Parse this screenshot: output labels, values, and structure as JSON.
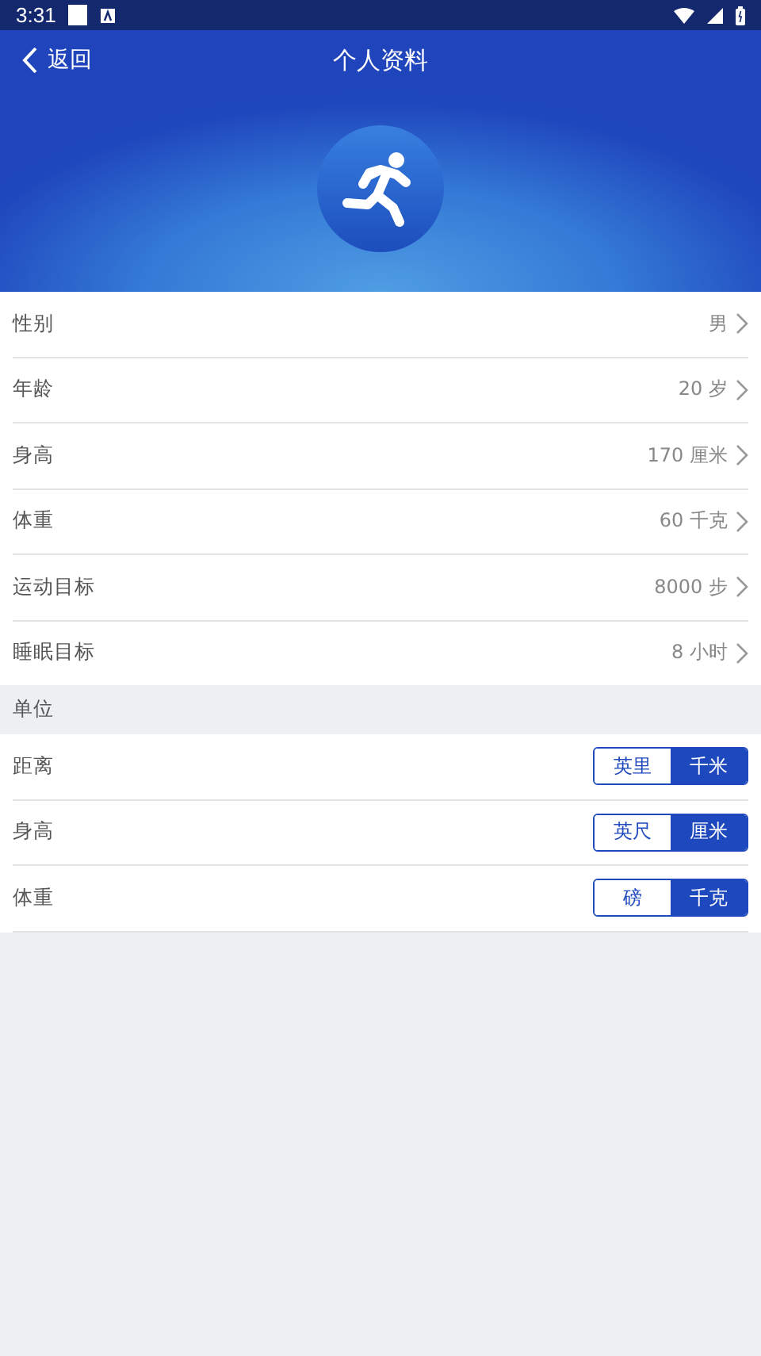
{
  "status_bar": {
    "time": "3:31"
  },
  "header": {
    "back": "返回",
    "title": "个人资料"
  },
  "profile": [
    {
      "label": "性别",
      "value": "男"
    },
    {
      "label": "年龄",
      "value": "20 岁"
    },
    {
      "label": "身高",
      "value": "170 厘米"
    },
    {
      "label": "体重",
      "value": "60 千克"
    },
    {
      "label": "运动目标",
      "value": "8000 步"
    },
    {
      "label": "睡眠目标",
      "value": "8 小时"
    }
  ],
  "units_section": {
    "title": "单位"
  },
  "units": [
    {
      "label": "距离",
      "options": [
        {
          "label": "英里",
          "selected": false
        },
        {
          "label": "千米",
          "selected": true
        }
      ]
    },
    {
      "label": "身高",
      "options": [
        {
          "label": "英尺",
          "selected": false
        },
        {
          "label": "厘米",
          "selected": true
        }
      ]
    },
    {
      "label": "体重",
      "options": [
        {
          "label": "磅",
          "selected": false
        },
        {
          "label": "千克",
          "selected": true
        }
      ]
    }
  ]
}
